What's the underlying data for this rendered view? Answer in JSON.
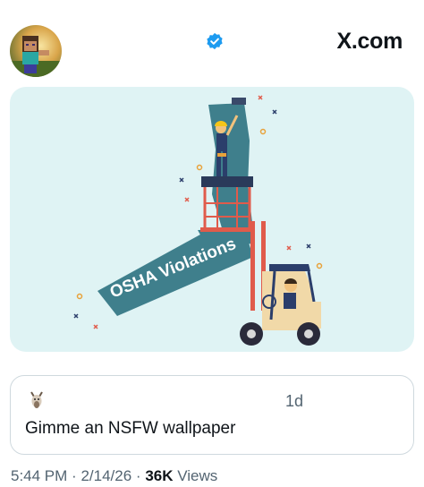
{
  "header": {
    "brand": "X.com",
    "avatar_icon": "minecraft-character-avatar",
    "verified_icon": "verified-badge-icon"
  },
  "media": {
    "banner_text": "OSHA Violations",
    "accent_color": "#3f7f8c",
    "background_color": "#dff3f4"
  },
  "quote": {
    "time": "1d",
    "text": "Gimme an NSFW wallpaper",
    "avatar_icon": "goat-avatar"
  },
  "meta": {
    "time": "5:44 PM",
    "separator": "·",
    "date": "2/14/26",
    "separator2": "·",
    "views_count": "36K",
    "views_label": "Views"
  },
  "colors": {
    "verified_blue": "#1d9bf0",
    "muted_text": "#536471"
  }
}
